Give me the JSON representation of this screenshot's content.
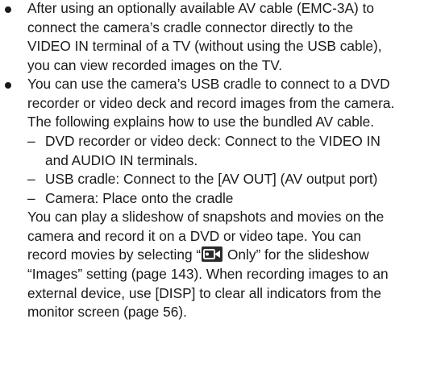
{
  "bullet1": {
    "lines": [
      "After using an optionally available AV cable (EMC-3A) to",
      "connect the camera’s cradle connector directly to the",
      "VIDEO IN terminal of a TV (without using the USB cable),",
      "you can view recorded images on the TV."
    ]
  },
  "bullet2": {
    "lines": [
      "You can use the camera’s USB cradle to connect to a DVD",
      "recorder or video deck and record images from the camera.",
      "The following explains how to use the bundled AV cable."
    ],
    "dash_marker": "–",
    "items": [
      {
        "line1": "DVD recorder or video deck: Connect to the VIDEO IN",
        "line2": "and AUDIO IN terminals."
      },
      {
        "line1": "USB cradle: Connect to the [AV OUT] (AV output port)"
      },
      {
        "line1": "Camera: Place onto the cradle"
      }
    ],
    "para": {
      "l1": "You can play a slideshow of snapshots and movies on the",
      "l2": "camera and record it on a DVD or video tape. You can",
      "l3_pre": "record movies by selecting “",
      "l3_post": " Only” for the slideshow",
      "l4": "“Images” setting (page 143). When recording images to an",
      "l5": "external device, use [DISP] to clear all indicators from the",
      "l6": "monitor screen (page 56)."
    }
  },
  "icons": {
    "movie": "movie-icon"
  }
}
